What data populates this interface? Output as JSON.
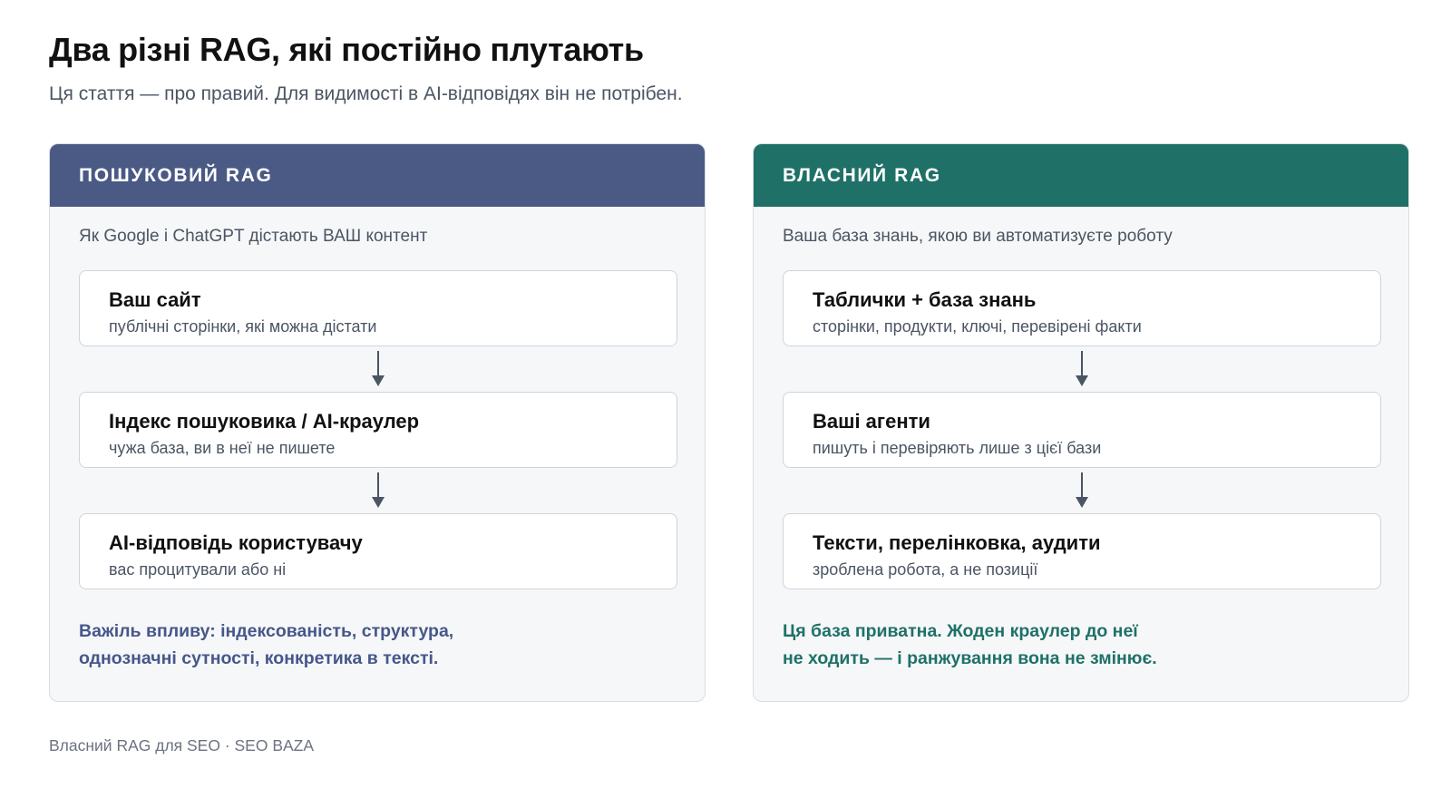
{
  "title": "Два різні RAG, які постійно плутають",
  "subtitle": "Ця стаття — про правий. Для видимості в AI-відповідях він не потрібен.",
  "panels": {
    "left": {
      "header": "ПОШУКОВИЙ RAG",
      "subtitle": "Як Google і ChatGPT дістають ВАШ контент",
      "steps": [
        {
          "title": "Ваш сайт",
          "desc": "публічні сторінки, які можна дістати"
        },
        {
          "title": "Індекс пошуковика / AI-краулер",
          "desc": "чужа база, ви в неї не пишете"
        },
        {
          "title": "AI-відповідь користувачу",
          "desc": "вас процитували або ні"
        }
      ],
      "note_line1": "Важіль впливу: індексованість, структура,",
      "note_line2": "однозначні сутності, конкретика в тексті.",
      "color": "#4a5a85"
    },
    "right": {
      "header": "ВЛАСНИЙ RAG",
      "subtitle": "Ваша база знань, якою ви автоматизуєте роботу",
      "steps": [
        {
          "title": "Таблички + база знань",
          "desc": "сторінки, продукти, ключі, перевірені факти"
        },
        {
          "title": "Ваші агенти",
          "desc": "пишуть і перевіряють лише з цієї бази"
        },
        {
          "title": "Тексти, перелінковка, аудити",
          "desc": "зроблена робота, а не позиції"
        }
      ],
      "note_line1": "Ця база приватна. Жоден краулер до неї",
      "note_line2": "не ходить — і ранжування вона не змінює.",
      "color": "#1f7167"
    }
  },
  "footer": "Власний RAG для SEO · SEO BAZA"
}
